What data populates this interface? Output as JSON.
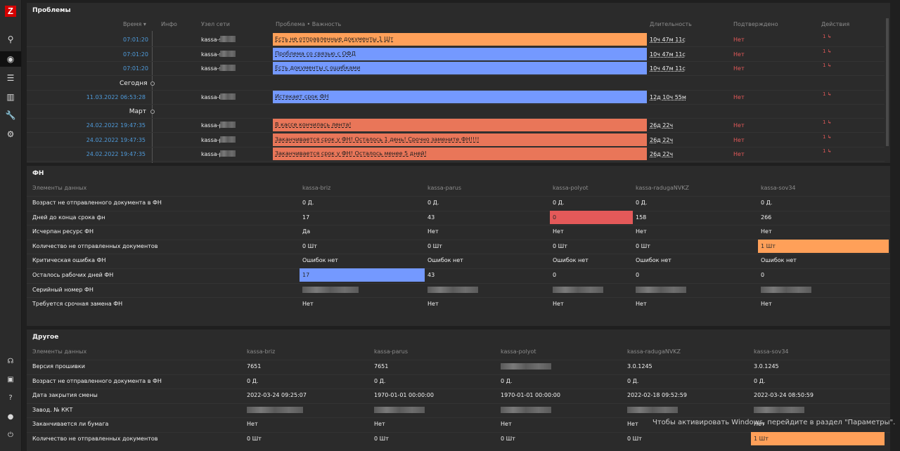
{
  "app": {
    "logo": "Z"
  },
  "sidebar": {
    "top": [
      {
        "icon": "search-icon",
        "glyph": "⚲"
      },
      {
        "icon": "eye-icon",
        "glyph": "◉"
      },
      {
        "icon": "list-icon",
        "glyph": "☰"
      },
      {
        "icon": "bar-chart-icon",
        "glyph": "▥"
      },
      {
        "icon": "wrench-icon",
        "glyph": "🔧"
      },
      {
        "icon": "settings-icon",
        "glyph": "⚙"
      }
    ],
    "bottom": [
      {
        "icon": "headset-icon",
        "glyph": "☊"
      },
      {
        "icon": "zabbix-share-icon",
        "glyph": "▣"
      },
      {
        "icon": "help-icon",
        "glyph": "?"
      },
      {
        "icon": "user-icon",
        "glyph": "●"
      },
      {
        "icon": "power-icon",
        "glyph": "⏻"
      }
    ]
  },
  "problems": {
    "title": "Проблемы",
    "headers": {
      "time": "Время ▾",
      "info": "Инфо",
      "host": "Узел сети",
      "problem": "Проблема • Важность",
      "duration": "Длительность",
      "ack": "Подтверждено",
      "actions": "Действия"
    },
    "rows": [
      {
        "time": "07:01:20",
        "host": "kassa-s",
        "problem": "Есть не отправленные документы 1 Шт",
        "duration": "10ч 47м 11с",
        "ack": "Нет",
        "actions": "1",
        "severity": "warning"
      },
      {
        "time": "07:01:20",
        "host": "kassa-s",
        "problem": "Проблема со связью с ОФД",
        "duration": "10ч 47м 11с",
        "ack": "Нет",
        "actions": "1",
        "severity": "info"
      },
      {
        "time": "07:01:20",
        "host": "kassa-s",
        "problem": "Есть документы с ошибками",
        "duration": "10ч 47м 11с",
        "ack": "Нет",
        "actions": "1",
        "severity": "info"
      },
      {
        "divider": "Сегодня"
      },
      {
        "time": "11.03.2022 06:53:28",
        "host": "kassa-b",
        "problem": "Истекает срок ФН",
        "duration": "12д 10ч 55м",
        "ack": "Нет",
        "actions": "1",
        "severity": "info"
      },
      {
        "divider": "Март"
      },
      {
        "time": "24.02.2022 19:47:35",
        "host": "kassa-p",
        "problem": "В кассе кончилась лента!",
        "duration": "26д 22ч",
        "ack": "Нет",
        "actions": "1",
        "severity": "average"
      },
      {
        "time": "24.02.2022 19:47:35",
        "host": "kassa-p",
        "problem": "Заканчивается срок у ФН! Осталось 1 день! Срочно замените ФН!!!!",
        "duration": "26д 22ч",
        "ack": "Нет",
        "actions": "1",
        "severity": "average"
      },
      {
        "time": "24.02.2022 19:47:35",
        "host": "kassa-p",
        "problem": "Заканчивается срок у ФН! Осталось менее 5 дней!",
        "duration": "26д 22ч",
        "ack": "Нет",
        "actions": "1",
        "severity": "average"
      }
    ]
  },
  "fn": {
    "title": "ФН",
    "header_label": "Элементы данных",
    "hosts": [
      "kassa-briz",
      "kassa-parus",
      "kassa-polyot",
      "kassa-radugaNVKZ",
      "kassa-sov34"
    ],
    "rows": [
      {
        "label": "Возраст не отправленного документа в ФН",
        "values": [
          "0 Д.",
          "0 Д.",
          "0 Д.",
          "0 Д.",
          "0 Д."
        ]
      },
      {
        "label": "Дней до конца срока фн",
        "values": [
          "17",
          "43",
          "0",
          "158",
          "266"
        ]
      },
      {
        "label": "Исчерпан ресурс ФН",
        "values": [
          "Да",
          "Нет",
          "Нет",
          "Нет",
          "Нет"
        ]
      },
      {
        "label": "Количество не отправленных документов",
        "values": [
          "0 Шт",
          "0 Шт",
          "0 Шт",
          "0 Шт",
          "1 Шт"
        ]
      },
      {
        "label": "Критическая ошибка ФН",
        "values": [
          "Ошибок нет",
          "Ошибок нет",
          "Ошибок нет",
          "Ошибок нет",
          "Ошибок нет"
        ]
      },
      {
        "label": "Осталось рабочих дней ФН",
        "values": [
          "17",
          "43",
          "0",
          "0",
          "0"
        ]
      },
      {
        "label": "Серийный номер ФН",
        "values": [
          "",
          "",
          "",
          "",
          ""
        ]
      },
      {
        "label": "Требуется срочная замена ФН",
        "values": [
          "Нет",
          "Нет",
          "Нет",
          "Нет",
          "Нет"
        ]
      }
    ]
  },
  "other": {
    "title": "Другое",
    "header_label": "Элементы данных",
    "hosts": [
      "kassa-briz",
      "kassa-parus",
      "kassa-polyot",
      "kassa-radugaNVKZ",
      "kassa-sov34"
    ],
    "rows": [
      {
        "label": "Версия прошивки",
        "values": [
          "7651",
          "7651",
          "",
          "3.0.1245",
          "3.0.1245"
        ]
      },
      {
        "label": "Возраст не отправленного документа в ФН",
        "values": [
          "0 Д.",
          "0 Д.",
          "0 Д.",
          "0 Д.",
          "0 Д."
        ]
      },
      {
        "label": "Дата закрытия смены",
        "values": [
          "2022-03-24 09:25:07",
          "1970-01-01 00:00:00",
          "1970-01-01 00:00:00",
          "2022-02-18 09:52:59",
          "2022-03-24 08:50:59"
        ]
      },
      {
        "label": "Завод. № ККТ",
        "values": [
          "",
          "",
          "",
          "",
          ""
        ]
      },
      {
        "label": "Заканчивается ли бумага",
        "values": [
          "Нет",
          "Нет",
          "Нет",
          "Нет",
          "Нет"
        ]
      },
      {
        "label": "Количество не отправленных документов",
        "values": [
          "0 Шт",
          "0 Шт",
          "0 Шт",
          "0 Шт",
          "1 Шт"
        ]
      }
    ]
  },
  "watermark": "Чтобы активировать Windows, перейдите в раздел \"Параметры\".",
  "colors": {
    "warning": "#ffa059",
    "info": "#7499ff",
    "average": "#e97659",
    "disaster": "#e45959",
    "link": "#4f9bdb",
    "ack_no": "#e45959"
  }
}
